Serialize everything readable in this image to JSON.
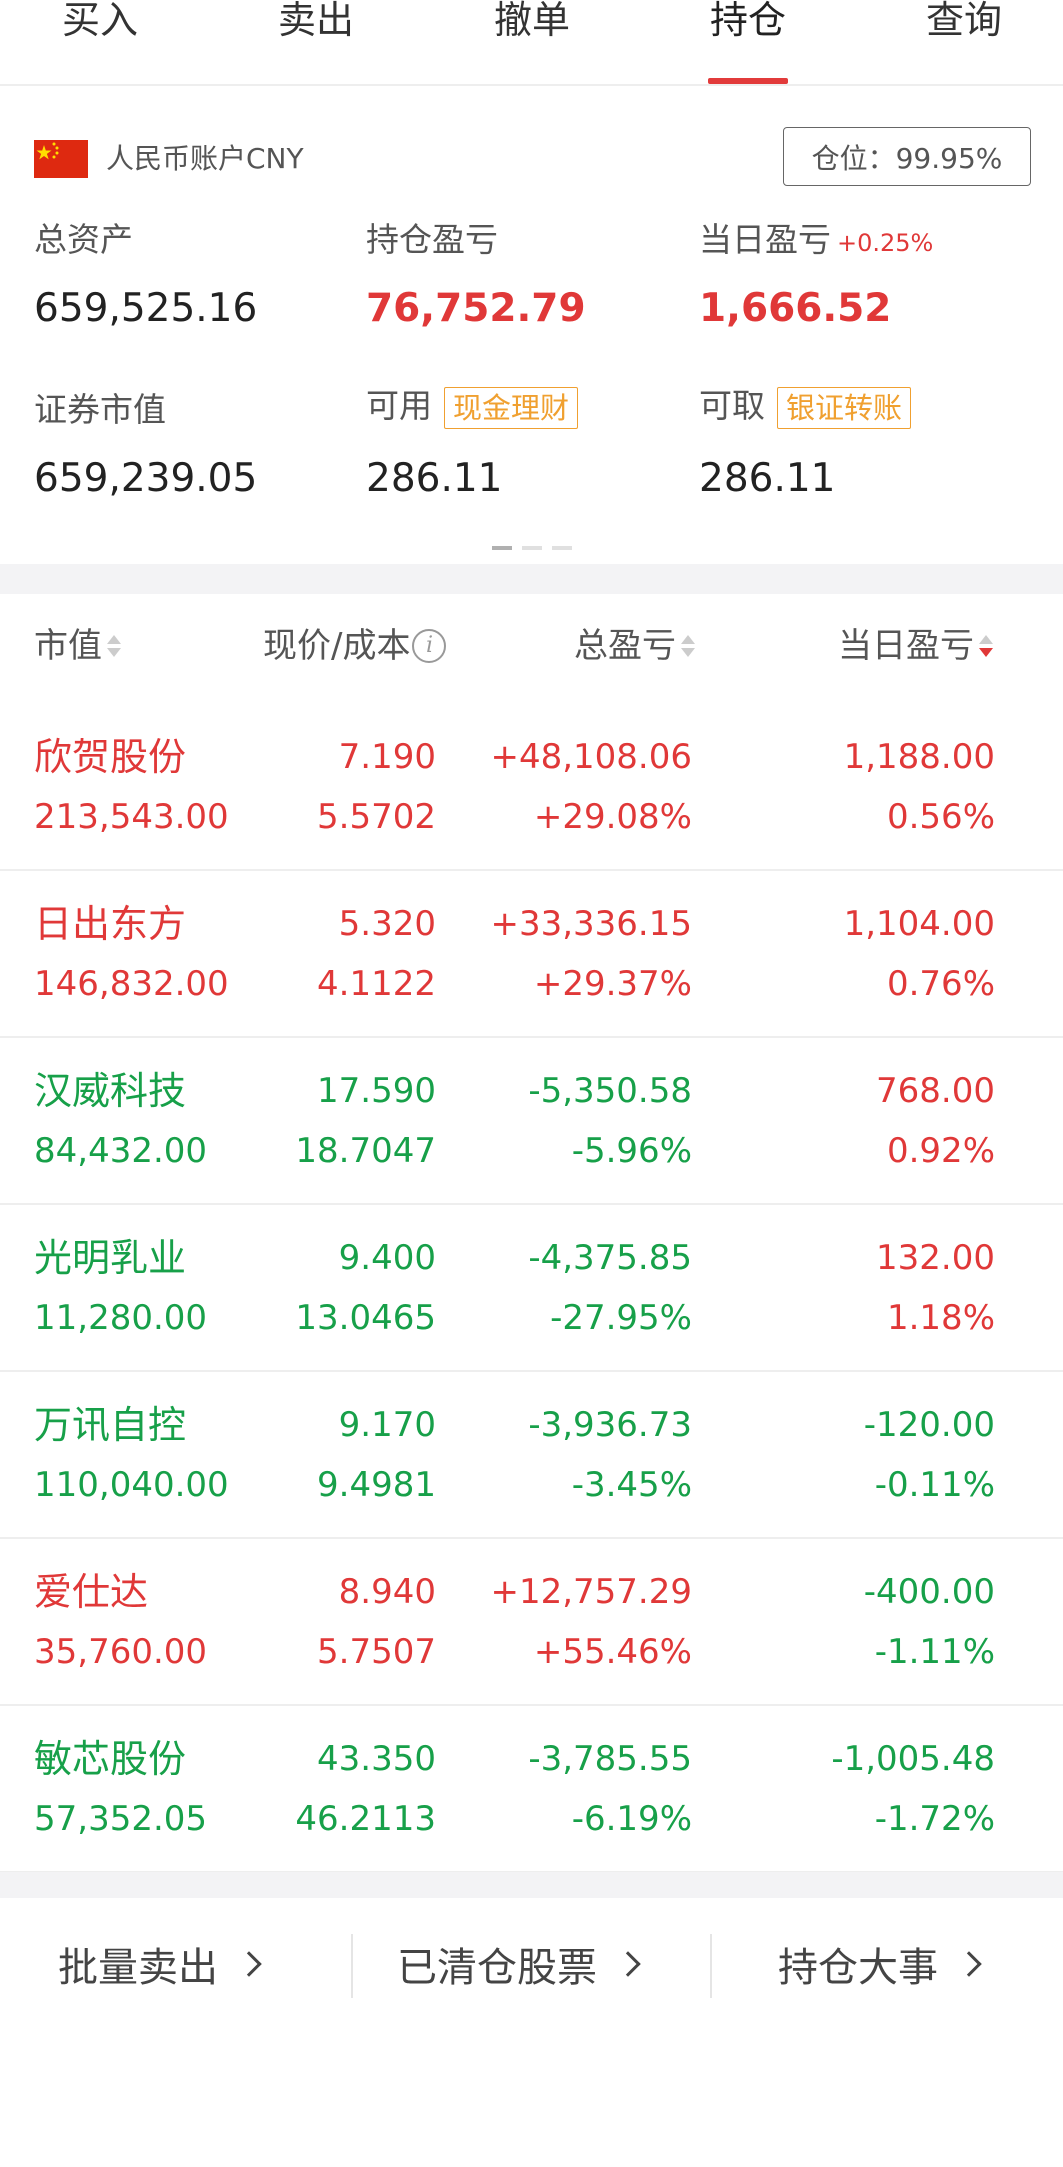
{
  "tabs": [
    "买入",
    "卖出",
    "撤单",
    "持仓",
    "查询"
  ],
  "active_tab": "持仓",
  "account": {
    "label": "人民币账户CNY",
    "position": "仓位：99.95%",
    "total_assets_label": "总资产",
    "total_assets": "659,525.16",
    "holding_pl_label": "持仓盈亏",
    "holding_pl": "76,752.79",
    "daily_pl_label": "当日盈亏",
    "daily_pl_pct": "+0.25%",
    "daily_pl": "1,666.52",
    "securities_value_label": "证券市值",
    "securities_value": "659,239.05",
    "available_label": "可用",
    "available_chip": "现金理财",
    "available": "286.11",
    "withdrawable_label": "可取",
    "withdrawable_chip": "银证转账",
    "withdrawable": "286.11"
  },
  "table": {
    "headers": {
      "market_value": "市值",
      "price_cost": "现价/成本",
      "total_pl": "总盈亏",
      "daily_pl": "当日盈亏"
    },
    "rows": [
      {
        "name": "欣贺股份",
        "market_value": "213,543.00",
        "price": "7.190",
        "cost": "5.5702",
        "total_pl": "+48,108.06",
        "total_pl_pct": "+29.08%",
        "daily_pl": "1,188.00",
        "daily_pl_pct": "0.56%",
        "name_color": "red",
        "total_color": "red",
        "daily_color": "red"
      },
      {
        "name": "日出东方",
        "market_value": "146,832.00",
        "price": "5.320",
        "cost": "4.1122",
        "total_pl": "+33,336.15",
        "total_pl_pct": "+29.37%",
        "daily_pl": "1,104.00",
        "daily_pl_pct": "0.76%",
        "name_color": "red",
        "total_color": "red",
        "daily_color": "red"
      },
      {
        "name": "汉威科技",
        "market_value": "84,432.00",
        "price": "17.590",
        "cost": "18.7047",
        "total_pl": "-5,350.58",
        "total_pl_pct": "-5.96%",
        "daily_pl": "768.00",
        "daily_pl_pct": "0.92%",
        "name_color": "green",
        "total_color": "green",
        "daily_color": "red"
      },
      {
        "name": "光明乳业",
        "market_value": "11,280.00",
        "price": "9.400",
        "cost": "13.0465",
        "total_pl": "-4,375.85",
        "total_pl_pct": "-27.95%",
        "daily_pl": "132.00",
        "daily_pl_pct": "1.18%",
        "name_color": "green",
        "total_color": "green",
        "daily_color": "red"
      },
      {
        "name": "万讯自控",
        "market_value": "110,040.00",
        "price": "9.170",
        "cost": "9.4981",
        "total_pl": "-3,936.73",
        "total_pl_pct": "-3.45%",
        "daily_pl": "-120.00",
        "daily_pl_pct": "-0.11%",
        "name_color": "green",
        "total_color": "green",
        "daily_color": "green"
      },
      {
        "name": "爱仕达",
        "market_value": "35,760.00",
        "price": "8.940",
        "cost": "5.7507",
        "total_pl": "+12,757.29",
        "total_pl_pct": "+55.46%",
        "daily_pl": "-400.00",
        "daily_pl_pct": "-1.11%",
        "name_color": "red",
        "total_color": "red",
        "daily_color": "green"
      },
      {
        "name": "敏芯股份",
        "market_value": "57,352.05",
        "price": "43.350",
        "cost": "46.2113",
        "total_pl": "-3,785.55",
        "total_pl_pct": "-6.19%",
        "daily_pl": "-1,005.48",
        "daily_pl_pct": "-1.72%",
        "name_color": "green",
        "total_color": "green",
        "daily_color": "green"
      }
    ]
  },
  "actions": {
    "batch_sell": "批量卖出",
    "cleared_stocks": "已清仓股票",
    "holding_events": "持仓大事"
  },
  "colors": {
    "red": "#e03838",
    "green": "#17a049",
    "accent_orange": "#f0a030",
    "tab_underline": "#e23b3b"
  }
}
